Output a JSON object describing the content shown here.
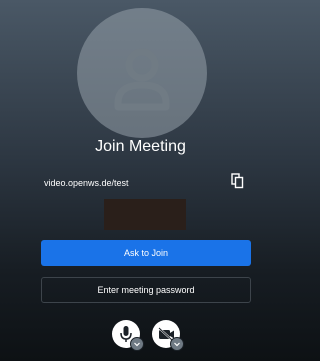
{
  "meeting": {
    "title": "Join Meeting",
    "url": "video.openws.de/test"
  },
  "name_input": {
    "value": "",
    "placeholder": ""
  },
  "buttons": {
    "join_label": "Ask to Join",
    "password_label": "Enter meeting password"
  },
  "icons": {
    "avatar": "person-avatar-icon",
    "copy": "copy-icon",
    "mic": "microphone-icon",
    "camera": "camera-off-icon"
  },
  "colors": {
    "accent": "#1a73e8",
    "background_top": "#4a5866",
    "background_bottom": "#0d1114"
  }
}
